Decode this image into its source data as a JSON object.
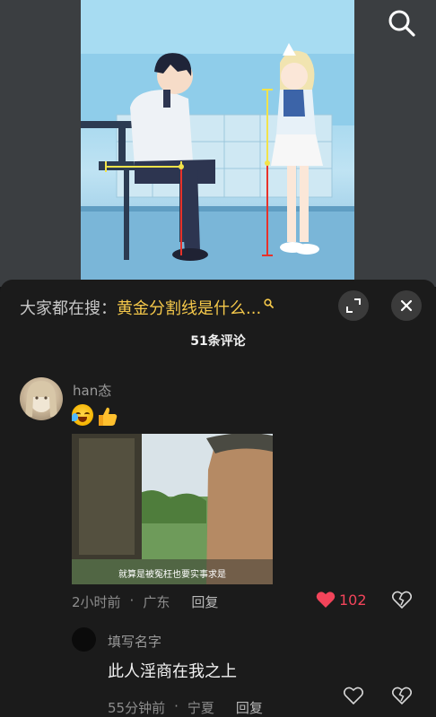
{
  "top": {
    "search_icon": "search-icon"
  },
  "search_hint": {
    "prefix": "大家都在搜：",
    "query": "黄金分割线是什么...",
    "icon": "small-search-icon"
  },
  "panel": {
    "comment_count_title": "51条评论",
    "expand_icon": "expand-icon",
    "close_icon": "close-icon"
  },
  "comments": [
    {
      "username": "han态",
      "emojis": [
        "laughing-crying-emoji",
        "thumbs-up-emoji"
      ],
      "image_caption": "就算是被冤枉也要实事求是",
      "time": "2小时前",
      "location": "广东",
      "reply_label": "回复",
      "likes": "102",
      "liked": true
    }
  ],
  "replies": [
    {
      "username": "填写名字",
      "text": "此人淫商在我之上",
      "time": "55分钟前",
      "location": "宁夏",
      "reply_label": "回复"
    }
  ],
  "colors": {
    "accent_query": "#f5c84a",
    "like_red": "#f2445a",
    "panel_bg": "#1b1b1b"
  }
}
